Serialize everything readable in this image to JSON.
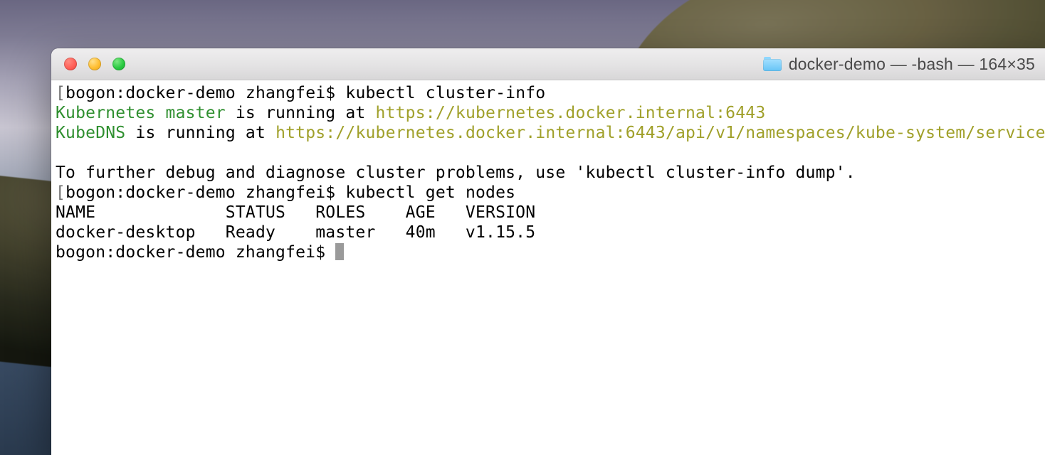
{
  "window": {
    "title": "docker-demo — -bash — 164×35",
    "folder_icon": "folder-icon"
  },
  "colors": {
    "prompt_service": "#2f8f2f",
    "prompt_url": "#a0a02a"
  },
  "terminal": {
    "prompt1": {
      "bracket_open": "[",
      "host_path_user": "bogon:docker-demo zhangfei$ ",
      "command": "kubectl cluster-info"
    },
    "line_master": {
      "service": "Kubernetes master",
      "mid": " is running at ",
      "url": "https://kubernetes.docker.internal:6443"
    },
    "line_dns": {
      "service": "KubeDNS",
      "mid": " is running at ",
      "url": "https://kubernetes.docker.internal:6443/api/v1/namespaces/kube-system/service"
    },
    "blank1": " ",
    "tip": "To further debug and diagnose cluster problems, use 'kubectl cluster-info dump'.",
    "prompt2": {
      "bracket_open": "[",
      "host_path_user": "bogon:docker-demo zhangfei$ ",
      "command": "kubectl get nodes"
    },
    "table_header": "NAME             STATUS   ROLES    AGE   VERSION",
    "table_row": "docker-desktop   Ready    master   40m   v1.15.5",
    "prompt3": {
      "host_path_user": "bogon:docker-demo zhangfei$ "
    }
  }
}
